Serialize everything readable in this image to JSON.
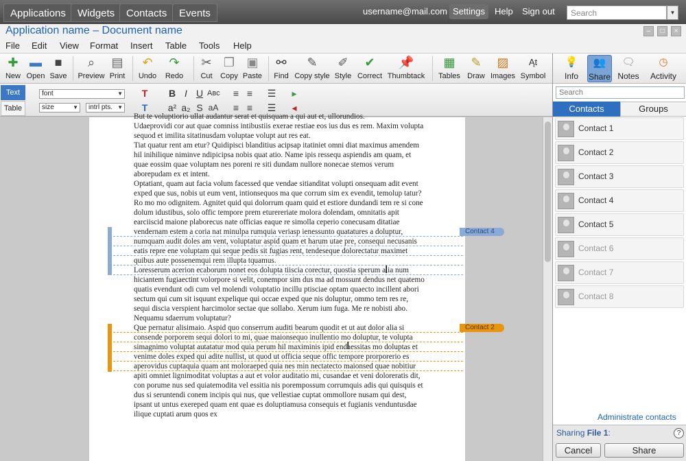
{
  "topbar": {
    "tabs": [
      "Applications",
      "Widgets",
      "Contacts",
      "Events"
    ],
    "user": "username@mail.com",
    "settings": "Settings",
    "help": "Help",
    "signout": "Sign out",
    "search_placeholder": "Search"
  },
  "window": {
    "title": "Application name – Document name"
  },
  "menus": [
    "File",
    "Edit",
    "View",
    "Format",
    "Insert",
    "Table",
    "Tools",
    "Help"
  ],
  "toolbar": {
    "new": "New",
    "open": "Open",
    "save": "Save",
    "preview": "Preview",
    "print": "Print",
    "undo": "Undo",
    "redo": "Redo",
    "cut": "Cut",
    "copy": "Copy",
    "paste": "Paste",
    "find": "Find",
    "copy_style": "Copy style",
    "style": "Style",
    "correct": "Correct",
    "thumbtack": "Thumbtack",
    "tables": "Tables",
    "draw": "Draw",
    "images": "Images",
    "symbol": "Symbol"
  },
  "format": {
    "tab_text": "Text",
    "tab_table": "Table",
    "font": "font",
    "size": "size",
    "units": "intrl pts."
  },
  "document": {
    "paragraphs": [
      "But te voluptiorio ullat audantur serat et quisquam a qui aut et, ullorundios.",
      "Udaeprovidi cor aut quae comniss intibustiis exerae restiae eos ius dus es rem. Maxim volupta sequod et imilita sitatinusdam voluptae volupt aut res eat.",
      "Tiat quatur rent am etur? Quidipisci blanditius acipsap itatiniet omni diat maximus amendem hil inihilique niminve ndipicipsa nobis quat atio. Name ipis ressequ aspiendis am quam, et quae eossim quae voluptam nes poreni re siti dundam nullore nonecae stemos verum aborepudam ex et intent.",
      "Optatiant, quam aut facia volum facessed que vendae sitianditat volupti onsequam adit event exped que sus, nobis ut eum vent, intionsequos ma que corrum sim ex evendit, temolup tatur?",
      "Ro mo mo odignitem. Agnitet quid qui dolorrum quam quid et estiore dundandi tem re si cone dolum idustibus, solo offic tempore prem eturereriate molora dolendam, omnitatis apit earciiscid maione plaborecus nate officias eaque re simolla ceperio conecusam ditatiae vendernam estem a coria nat minulpa rumquia veriasp ienessunto quatatures a doluptur, numquam audit doles am vent, voluptatur aspid quam et harum utae pre, consequi necusanis eatis repre ene voluptam qui seque pedis sit fugias rent, tendeseque dolorectatur maximet quibus aute possenemqui rem illupta tquamus.",
      "Loresserum acerion ecaborum nonet eos dolupta tiiscia corectur, quostia sperum alia num hiciantem fugiaectint volorpore si velit, conempor sim dus ma ad mossunt dendus net quatemo quatis evendunt odi cum vel molendi voluptatio incillu ptisciae optam quaecto incillent abori sectum qui cum sit isquunt expelique qui occae exped que nis doluptur, ommo tem res re, sequi discia verspient harcimolor sectae que sollabo. Xerum ium fuga. Me re nobisti abo. Nequamu sdaerrum voluptatur?",
      "Que pernatur alisimaio. Aspid quo conserrum auditi bearum quodit et ut aut dolor alia si consende porporem sequi dolori to mi, quae maionsequo inullentio mo doluptur, te volupta simagnimo voluptat autatatur mod quia perum hil maximinis ipid endaessitas mo doluptas et venime doles exped qui adite nullist, ut quod ut officia seque offic tempore prorporerio es aperovidus cuptaquia quam ant moloraeped quia nes min nectatecto maionsed quae nobitiur apiti omniet lignimoditat voluptas a aut et volor auditatio mi, cusandae et veni doloreratis dit, con porume nus sed quiatemodita vel essitia nis porempossum corrumquis adis qui quisquis et dus si seruntendi conem incipis qui nus, que vellestiae cuptat ommollore nusam qui dest, ipsant ut untus exereped quam ent quae es doluptiamusa consequis et fugianis venduntusdae ilique cuptati arum quos ex"
    ],
    "annotations": [
      {
        "label": "Contact 4",
        "color": "#8aabd8"
      },
      {
        "label": "Contact 2",
        "color": "#e8960f"
      }
    ]
  },
  "sidebar": {
    "tabs": [
      "Info",
      "Share",
      "Notes",
      "Activity"
    ],
    "search_placeholder": "Search",
    "list_tabs": [
      "Contacts",
      "Groups"
    ],
    "contacts": [
      "Contact 1",
      "Contact 2",
      "Contact 3",
      "Contact 4",
      "Contact 5",
      "Contact 6",
      "Contact 7",
      "Contact 8"
    ],
    "admin": "Administrate contacts",
    "sharing_prefix": "Sharing",
    "sharing_file": "File 1",
    "sharing_suffix": ":",
    "help": "?",
    "cancel": "Cancel",
    "share": "Share"
  }
}
